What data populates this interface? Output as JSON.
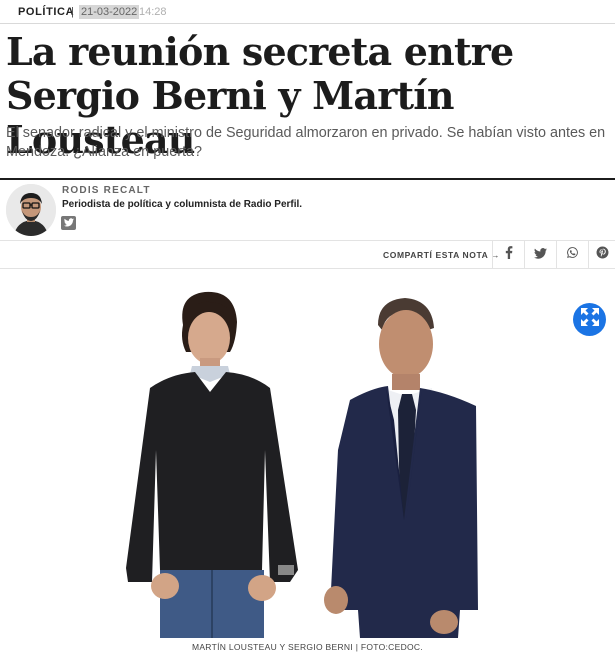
{
  "article": {
    "section": "POLÍTICA",
    "separator": "|",
    "date": "21-03-2022",
    "time": "14:28",
    "headline": "La reunión secreta entre Sergio Berni y Martín Lousteau",
    "summary": "El senador radical y el ministro de Seguridad almorzaron en privado. Se habían visto antes en Mendoza. ¿Alianza en puerta?"
  },
  "author": {
    "name": "RODIS RECALT",
    "role": "Periodista de política y columnista de Radio Perfil.",
    "social_icon": "twitter-icon"
  },
  "share": {
    "label": "COMPARTÍ ESTA NOTA →",
    "buttons": [
      "facebook-icon",
      "twitter-icon",
      "whatsapp-icon",
      "pinterest-icon"
    ]
  },
  "photo": {
    "caption": "MARTÍN LOUSTEAU Y SERGIO BERNI | FOTO:CEDOC.",
    "expand_icon": "expand-icon"
  },
  "colors": {
    "accent": "#1b74e4",
    "text": "#1c1c1c",
    "muted": "#5a5a5a"
  }
}
